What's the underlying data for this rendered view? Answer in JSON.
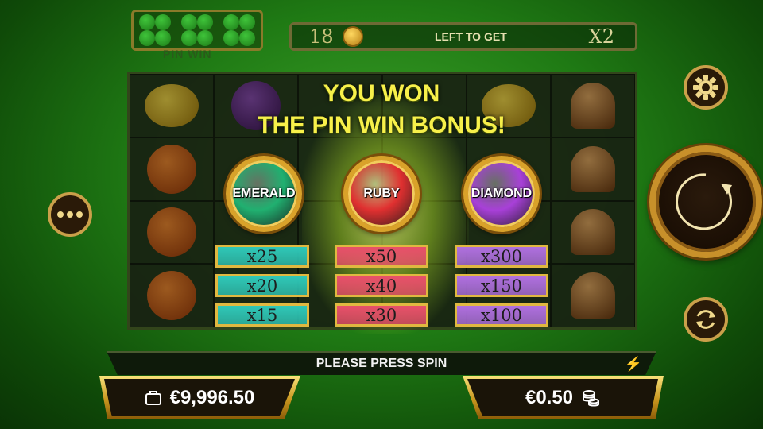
{
  "top_bar": {
    "clover_count": 3,
    "logo_subtitle": "PIN WIN",
    "spins_left": "18",
    "left_to_get_label": "LEFT TO GET",
    "multiplier": "X2"
  },
  "reels": {
    "grid": [
      [
        "lemon",
        "plum",
        "",
        "",
        "lemon",
        "bell"
      ],
      [
        "orange",
        "",
        "",
        "",
        "",
        "bell"
      ],
      [
        "orange",
        "",
        "",
        "",
        "",
        "bell"
      ],
      [
        "orange",
        "",
        "",
        "",
        "",
        "bell"
      ]
    ]
  },
  "bonus": {
    "headline_line1": "YOU WON",
    "headline_line2": "THE PIN WIN BONUS!",
    "gems": [
      {
        "label": "EMERALD",
        "color": "#20b070",
        "multipliers": [
          "x25",
          "x20",
          "x15"
        ],
        "tile_color": "#2fc8b8"
      },
      {
        "label": "RUBY",
        "color": "#e03030",
        "multipliers": [
          "x50",
          "x40",
          "x30"
        ],
        "tile_color": "#e8506a"
      },
      {
        "label": "DIAMOND",
        "color": "#a840d8",
        "multipliers": [
          "x300",
          "x150",
          "x100"
        ],
        "tile_color": "#b070e0"
      }
    ]
  },
  "controls": {
    "menu_icon": "ellipsis-icon",
    "settings_icon": "gear-icon",
    "spin_icon": "spin-arrow-icon",
    "autoplay_icon": "autoplay-icon"
  },
  "status": {
    "message": "PLEASE PRESS SPIN",
    "turbo_icon": "lightning-icon"
  },
  "balance": {
    "amount": "€9,996.50",
    "icon": "wallet-icon"
  },
  "bet": {
    "amount": "€0.50",
    "icon": "coin-stack-icon"
  }
}
